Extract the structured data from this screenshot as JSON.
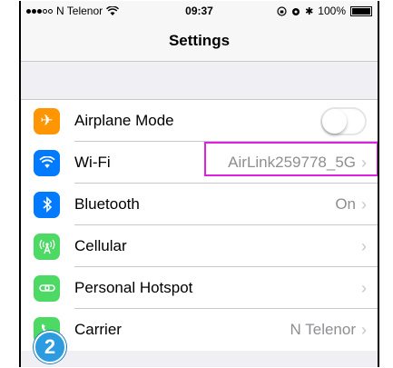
{
  "status_bar": {
    "carrier": "N Telenor",
    "time": "09:37",
    "battery": "100%"
  },
  "nav": {
    "title": "Settings"
  },
  "rows": [
    {
      "label": "Airplane Mode",
      "icon": "airplane-icon",
      "color": "#ff9500",
      "toggle": false
    },
    {
      "label": "Wi-Fi",
      "icon": "wifi-icon",
      "color": "#007aff",
      "value": "AirLink259778_5G"
    },
    {
      "label": "Bluetooth",
      "icon": "bluetooth-icon",
      "color": "#007aff",
      "value": "On"
    },
    {
      "label": "Cellular",
      "icon": "cellular-icon",
      "color": "#4cd964",
      "value": ""
    },
    {
      "label": "Personal Hotspot",
      "icon": "hotspot-icon",
      "color": "#4cd964",
      "value": ""
    },
    {
      "label": "Carrier",
      "icon": "phone-icon",
      "color": "#4cd964",
      "value": "N Telenor"
    }
  ],
  "annotation": {
    "step": "2",
    "highlight_color": "#e020e0",
    "badge_color": "#2d9be0"
  }
}
